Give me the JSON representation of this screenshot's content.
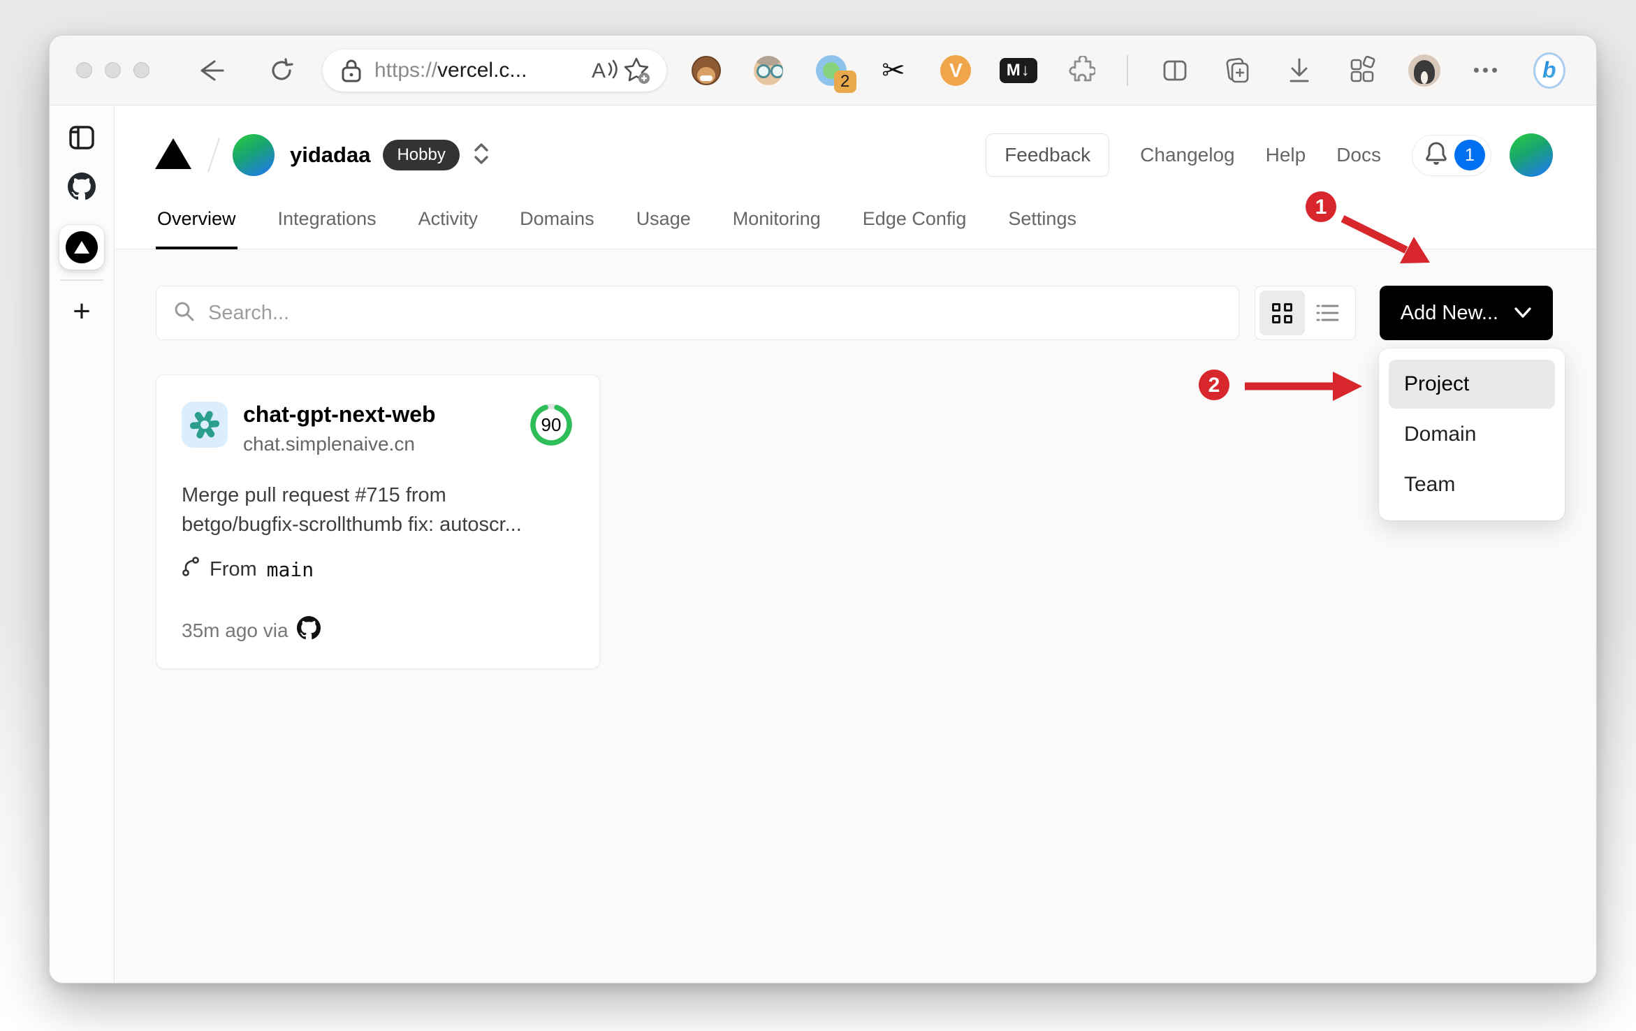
{
  "browser": {
    "url": {
      "scheme": "https://",
      "host": "vercel.c..."
    },
    "ext_badge_count": "2",
    "scissors_glyph": "✂",
    "video_ext_label": "V",
    "markdown_ext_label": "M↓",
    "menu_dots": "•••",
    "bing_label": "b"
  },
  "header": {
    "team": "yidadaa",
    "plan": "Hobby",
    "feedback": "Feedback",
    "links": [
      "Changelog",
      "Help",
      "Docs"
    ],
    "bell_count": "1"
  },
  "tabs": {
    "items": [
      "Overview",
      "Integrations",
      "Activity",
      "Domains",
      "Usage",
      "Monitoring",
      "Edge Config",
      "Settings"
    ],
    "active": "Overview"
  },
  "toolbar": {
    "search_placeholder": "Search...",
    "add_new": "Add New..."
  },
  "dropdown": {
    "items": [
      "Project",
      "Domain",
      "Team"
    ],
    "highlighted": "Project"
  },
  "card": {
    "name": "chat-gpt-next-web",
    "domain": "chat.simplenaive.cn",
    "score": "90",
    "desc_line1": "Merge pull request #715 from",
    "desc_line2": "betgo/bugfix-scrollthumb fix: autoscr...",
    "from_label": "From",
    "branch": "main",
    "meta": "35m ago via"
  },
  "annotations": {
    "step1": "1",
    "step2": "2"
  },
  "sidebar_plus": "+",
  "colors": {
    "accent_blue": "#0070f3",
    "annotation_red": "#d7262c",
    "score_green": "#2ebd59",
    "openai_teal": "#2b9e8e",
    "add_new_bg": "#000000"
  }
}
